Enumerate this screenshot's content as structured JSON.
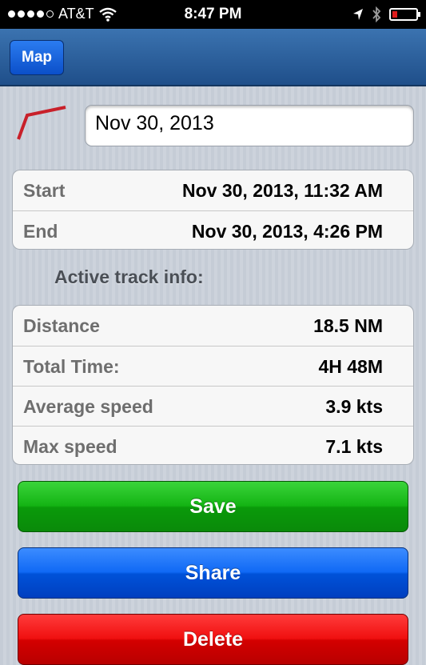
{
  "status_bar": {
    "carrier": "AT&T",
    "time": "8:47 PM",
    "battery_level": 0.2
  },
  "nav": {
    "map_label": "Map"
  },
  "track": {
    "name": "Nov 30, 2013"
  },
  "times": [
    {
      "label": "Start",
      "value": "Nov 30, 2013, 11:32 AM"
    },
    {
      "label": "End",
      "value": "Nov 30, 2013, 4:26 PM"
    }
  ],
  "info_heading": "Active track info:",
  "info": [
    {
      "label": "Distance",
      "value": "18.5 NM"
    },
    {
      "label": "Total Time:",
      "value": "4H 48M"
    },
    {
      "label": "Average speed",
      "value": "3.9 kts"
    },
    {
      "label": "Max speed",
      "value": "7.1 kts"
    }
  ],
  "actions": {
    "save_label": "Save",
    "share_label": "Share",
    "delete_label": "Delete"
  },
  "colors": {
    "save": "#14b414",
    "share": "#1069f5",
    "delete": "#f01010",
    "track_line": "#c8202a"
  }
}
